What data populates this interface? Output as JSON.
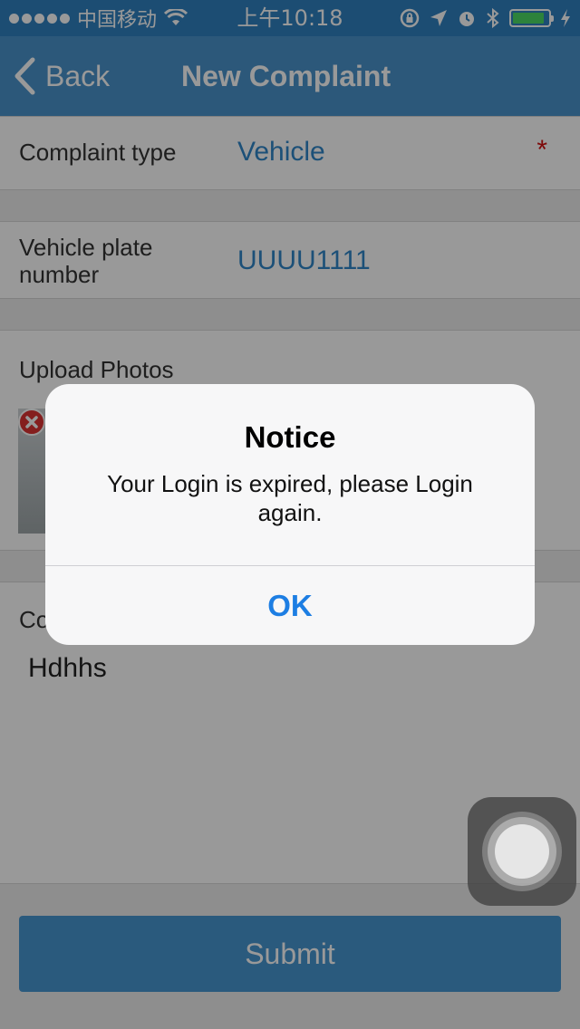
{
  "status_bar": {
    "carrier": "中国移动",
    "time": "上午10:18",
    "battery_level": 0.9,
    "battery_color": "#4cd964"
  },
  "nav": {
    "back_label": "Back",
    "title": "New Complaint",
    "bar_color": "#4a93cc"
  },
  "form": {
    "complaint_type": {
      "label": "Complaint type",
      "value": "Vehicle",
      "required_mark": "*"
    },
    "plate": {
      "label_line1": "Vehicle plate",
      "label_line2": "number",
      "value": "UUUU1111"
    },
    "photos": {
      "label": "Upload Photos"
    },
    "comment": {
      "label": "Co",
      "value": "Hdhhs"
    }
  },
  "submit_label": "Submit",
  "alert": {
    "title": "Notice",
    "message": "Your Login is expired, please Login again.",
    "ok_label": "OK",
    "ok_color": "#1d7ee3"
  }
}
